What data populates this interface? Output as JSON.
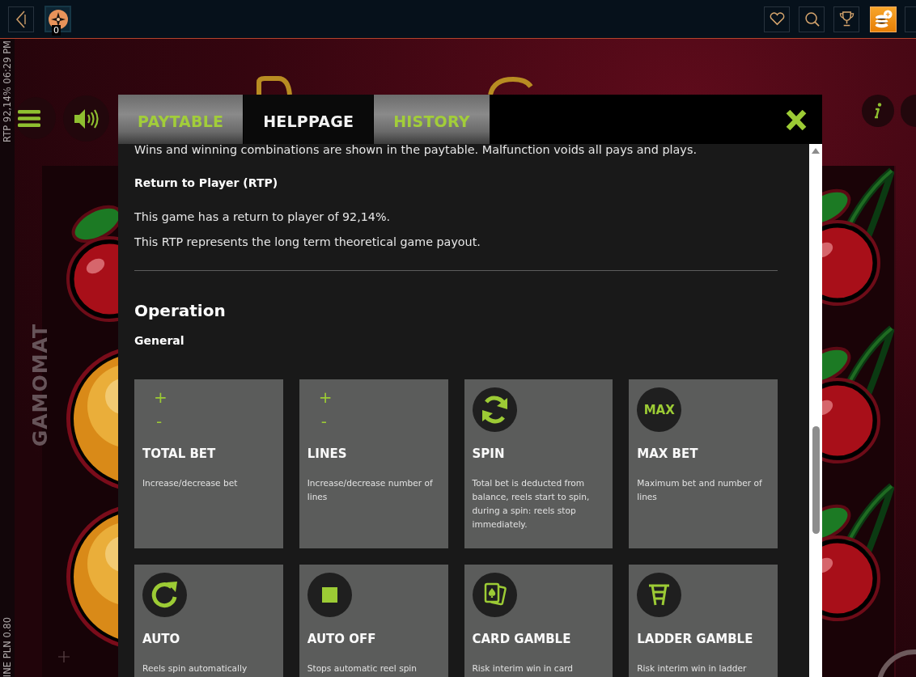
{
  "top_bar": {
    "badge_count": "0",
    "buttons": [
      {
        "kind": "favorites",
        "selected": false
      },
      {
        "kind": "search",
        "selected": false
      },
      {
        "kind": "trophy",
        "selected": false
      },
      {
        "kind": "coins",
        "selected": true
      }
    ]
  },
  "game": {
    "status_text": "RTP 92,14% 06:29 PM",
    "bet_text": "INE PLN 0.80",
    "brand": "GAMOMAT",
    "left_reel": [
      {
        "kind": "cherry"
      },
      {
        "kind": "orange"
      },
      {
        "kind": "orange"
      }
    ],
    "right_reel": [
      {
        "kind": "cherry"
      },
      {
        "kind": "cherry"
      },
      {
        "kind": "cherry"
      }
    ]
  },
  "dialog": {
    "tabs": [
      {
        "label": "PAYTABLE",
        "selected": false
      },
      {
        "label": "HELPPAGE",
        "selected": true
      },
      {
        "label": "HISTORY",
        "selected": false
      }
    ],
    "intro": "Wins and winning combinations are shown in the paytable. Malfunction voids all pays and plays.",
    "rtp_heading": "Return to Player (RTP)",
    "rtp_lines": [
      "This game has a return to player of 92,14%.",
      "This RTP represents the long term theoretical game payout."
    ],
    "section_title": "Operation",
    "subsection_title": "General",
    "controls": [
      {
        "kind": "plusminus",
        "plus": "+",
        "minus": "-",
        "title": "TOTAL BET",
        "description": "Increase/decrease bet"
      },
      {
        "kind": "plusminus",
        "plus": "+",
        "minus": "-",
        "title": "LINES",
        "description": "Increase/decrease number of lines"
      },
      {
        "kind": "spin",
        "title": "SPIN",
        "description": "Total bet is deducted from balance, reels start to spin, during a spin: reels stop immediately."
      },
      {
        "kind": "max",
        "icon_text": "MAX",
        "title": "MAX BET",
        "description": "Maximum bet and number of lines"
      },
      {
        "kind": "auto",
        "title": "AUTO",
        "description": "Reels spin automatically"
      },
      {
        "kind": "stop",
        "title": "AUTO OFF",
        "description": "Stops automatic reel spin"
      },
      {
        "kind": "cards",
        "title": "CARD GAMBLE",
        "description": "Risk interim win in card"
      },
      {
        "kind": "ladder",
        "title": "LADDER GAMBLE",
        "description": "Risk interim win in ladder"
      }
    ]
  }
}
